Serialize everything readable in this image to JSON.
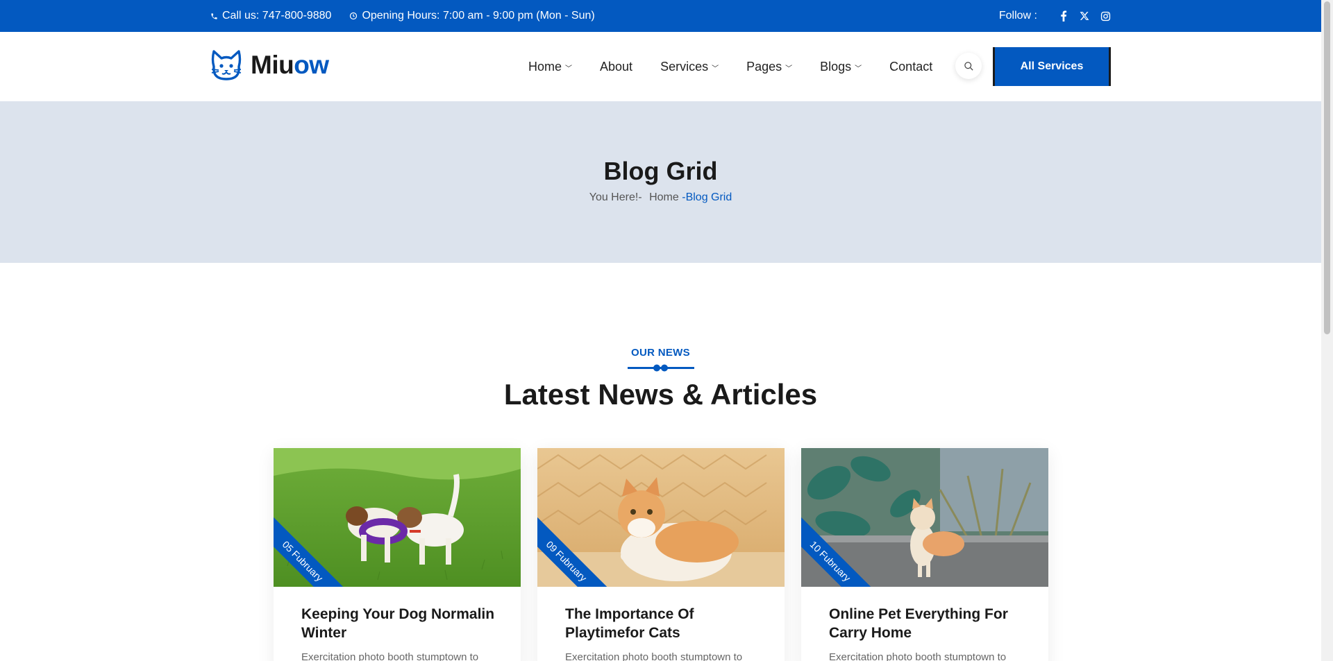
{
  "topbar": {
    "phone": "Call us: 747-800-9880",
    "hours": "Opening Hours: 7:00 am - 9:00 pm (Mon - Sun)",
    "follow": "Follow :",
    "social": [
      "facebook-icon",
      "x-icon",
      "instagram-icon"
    ]
  },
  "brand": {
    "part1": "Miu",
    "part2": "ow"
  },
  "nav": {
    "items": [
      {
        "label": "Home",
        "dropdown": true
      },
      {
        "label": "About",
        "dropdown": false
      },
      {
        "label": "Services",
        "dropdown": true
      },
      {
        "label": "Pages",
        "dropdown": true
      },
      {
        "label": "Blogs",
        "dropdown": true
      },
      {
        "label": "Contact",
        "dropdown": false
      }
    ],
    "cta": "All Services"
  },
  "hero": {
    "title": "Blog Grid",
    "crumb_prefix": "You Here!-",
    "crumb_home": "Home",
    "crumb_current": "-Blog Grid"
  },
  "section": {
    "eyebrow": "OUR NEWS",
    "title": "Latest News & Articles"
  },
  "posts": [
    {
      "date": "05 Fubruary",
      "title": "Keeping Your Dog Normalin Winter",
      "excerpt": "Exercitation photo booth stumptown to"
    },
    {
      "date": "09 Fubruary",
      "title": "The Importance Of Playtimefor Cats",
      "excerpt": "Exercitation photo booth stumptown to"
    },
    {
      "date": "10 Fubruary",
      "title": "Online Pet Everything For Carry Home",
      "excerpt": "Exercitation photo booth stumptown to"
    }
  ],
  "colors": {
    "primary": "#0359c0",
    "hero_bg": "#dce3ed",
    "text": "#1a1a1a"
  }
}
